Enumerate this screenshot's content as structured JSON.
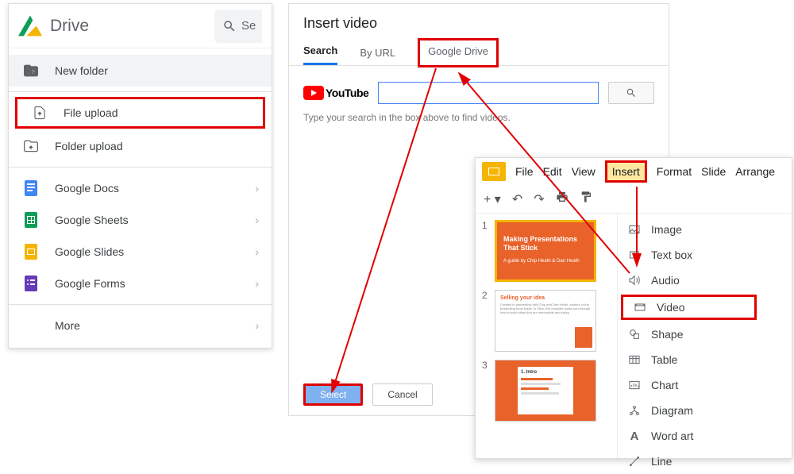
{
  "drive": {
    "title": "Drive",
    "search_placeholder": "Se",
    "items": [
      {
        "label": "New folder",
        "icon": "folder-plus",
        "chev": false,
        "selected": true
      },
      {
        "label": "File upload",
        "icon": "file-upload",
        "chev": false,
        "highlighted": true
      },
      {
        "label": "Folder upload",
        "icon": "folder-upload",
        "chev": false
      },
      {
        "label": "Google Docs",
        "icon": "docs",
        "chev": true,
        "color": "#4285f4"
      },
      {
        "label": "Google Sheets",
        "icon": "sheets",
        "chev": true,
        "color": "#0f9d58"
      },
      {
        "label": "Google Slides",
        "icon": "slides",
        "chev": true,
        "color": "#f4b400"
      },
      {
        "label": "Google Forms",
        "icon": "forms",
        "chev": true,
        "color": "#673ab7"
      },
      {
        "label": "More",
        "icon": "",
        "chev": true
      }
    ]
  },
  "insert_dialog": {
    "title": "Insert video",
    "tabs": [
      "Search",
      "By URL",
      "Google Drive"
    ],
    "youtube_label": "YouTube",
    "search_value": "",
    "hint": "Type your search in the box above to find videos.",
    "select_label": "Select",
    "cancel_label": "Cancel"
  },
  "slides": {
    "menubar": [
      "File",
      "Edit",
      "View",
      "Insert",
      "Format",
      "Slide",
      "Arrange"
    ],
    "thumbs": [
      {
        "num": "1",
        "title": "Making Presentations That Stick",
        "subtitle": "A guide by Chip Heath & Dan Heath"
      },
      {
        "num": "2",
        "title": "Selling your idea"
      },
      {
        "num": "3",
        "title": "1. Intro"
      }
    ],
    "insert_menu": [
      {
        "label": "Image",
        "icon": "image"
      },
      {
        "label": "Text box",
        "icon": "textbox"
      },
      {
        "label": "Audio",
        "icon": "audio"
      },
      {
        "label": "Video",
        "icon": "video",
        "highlighted": true
      },
      {
        "label": "Shape",
        "icon": "shape"
      },
      {
        "label": "Table",
        "icon": "table"
      },
      {
        "label": "Chart",
        "icon": "chart"
      },
      {
        "label": "Diagram",
        "icon": "diagram"
      },
      {
        "label": "Word art",
        "icon": "wordart"
      },
      {
        "label": "Line",
        "icon": "line"
      }
    ]
  }
}
